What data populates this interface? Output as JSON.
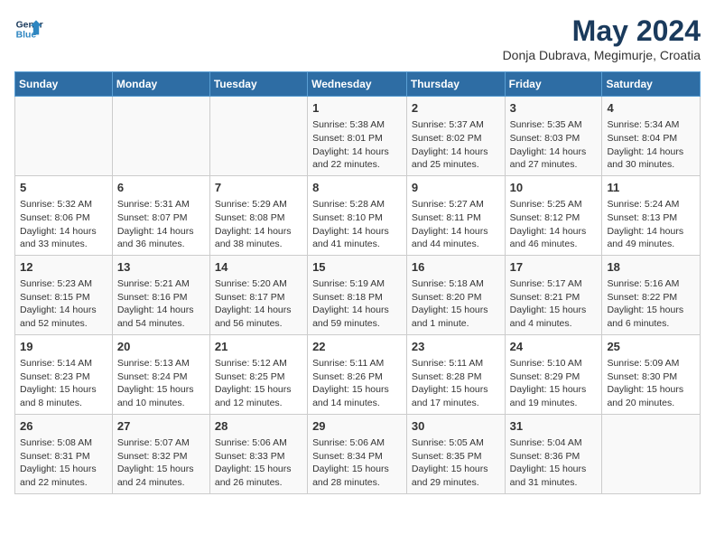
{
  "logo": {
    "line1": "General",
    "line2": "Blue"
  },
  "title": "May 2024",
  "subtitle": "Donja Dubrava, Megimurje, Croatia",
  "weekdays": [
    "Sunday",
    "Monday",
    "Tuesday",
    "Wednesday",
    "Thursday",
    "Friday",
    "Saturday"
  ],
  "weeks": [
    [
      {
        "day": "",
        "text": ""
      },
      {
        "day": "",
        "text": ""
      },
      {
        "day": "",
        "text": ""
      },
      {
        "day": "1",
        "text": "Sunrise: 5:38 AM\nSunset: 8:01 PM\nDaylight: 14 hours\nand 22 minutes."
      },
      {
        "day": "2",
        "text": "Sunrise: 5:37 AM\nSunset: 8:02 PM\nDaylight: 14 hours\nand 25 minutes."
      },
      {
        "day": "3",
        "text": "Sunrise: 5:35 AM\nSunset: 8:03 PM\nDaylight: 14 hours\nand 27 minutes."
      },
      {
        "day": "4",
        "text": "Sunrise: 5:34 AM\nSunset: 8:04 PM\nDaylight: 14 hours\nand 30 minutes."
      }
    ],
    [
      {
        "day": "5",
        "text": "Sunrise: 5:32 AM\nSunset: 8:06 PM\nDaylight: 14 hours\nand 33 minutes."
      },
      {
        "day": "6",
        "text": "Sunrise: 5:31 AM\nSunset: 8:07 PM\nDaylight: 14 hours\nand 36 minutes."
      },
      {
        "day": "7",
        "text": "Sunrise: 5:29 AM\nSunset: 8:08 PM\nDaylight: 14 hours\nand 38 minutes."
      },
      {
        "day": "8",
        "text": "Sunrise: 5:28 AM\nSunset: 8:10 PM\nDaylight: 14 hours\nand 41 minutes."
      },
      {
        "day": "9",
        "text": "Sunrise: 5:27 AM\nSunset: 8:11 PM\nDaylight: 14 hours\nand 44 minutes."
      },
      {
        "day": "10",
        "text": "Sunrise: 5:25 AM\nSunset: 8:12 PM\nDaylight: 14 hours\nand 46 minutes."
      },
      {
        "day": "11",
        "text": "Sunrise: 5:24 AM\nSunset: 8:13 PM\nDaylight: 14 hours\nand 49 minutes."
      }
    ],
    [
      {
        "day": "12",
        "text": "Sunrise: 5:23 AM\nSunset: 8:15 PM\nDaylight: 14 hours\nand 52 minutes."
      },
      {
        "day": "13",
        "text": "Sunrise: 5:21 AM\nSunset: 8:16 PM\nDaylight: 14 hours\nand 54 minutes."
      },
      {
        "day": "14",
        "text": "Sunrise: 5:20 AM\nSunset: 8:17 PM\nDaylight: 14 hours\nand 56 minutes."
      },
      {
        "day": "15",
        "text": "Sunrise: 5:19 AM\nSunset: 8:18 PM\nDaylight: 14 hours\nand 59 minutes."
      },
      {
        "day": "16",
        "text": "Sunrise: 5:18 AM\nSunset: 8:20 PM\nDaylight: 15 hours\nand 1 minute."
      },
      {
        "day": "17",
        "text": "Sunrise: 5:17 AM\nSunset: 8:21 PM\nDaylight: 15 hours\nand 4 minutes."
      },
      {
        "day": "18",
        "text": "Sunrise: 5:16 AM\nSunset: 8:22 PM\nDaylight: 15 hours\nand 6 minutes."
      }
    ],
    [
      {
        "day": "19",
        "text": "Sunrise: 5:14 AM\nSunset: 8:23 PM\nDaylight: 15 hours\nand 8 minutes."
      },
      {
        "day": "20",
        "text": "Sunrise: 5:13 AM\nSunset: 8:24 PM\nDaylight: 15 hours\nand 10 minutes."
      },
      {
        "day": "21",
        "text": "Sunrise: 5:12 AM\nSunset: 8:25 PM\nDaylight: 15 hours\nand 12 minutes."
      },
      {
        "day": "22",
        "text": "Sunrise: 5:11 AM\nSunset: 8:26 PM\nDaylight: 15 hours\nand 14 minutes."
      },
      {
        "day": "23",
        "text": "Sunrise: 5:11 AM\nSunset: 8:28 PM\nDaylight: 15 hours\nand 17 minutes."
      },
      {
        "day": "24",
        "text": "Sunrise: 5:10 AM\nSunset: 8:29 PM\nDaylight: 15 hours\nand 19 minutes."
      },
      {
        "day": "25",
        "text": "Sunrise: 5:09 AM\nSunset: 8:30 PM\nDaylight: 15 hours\nand 20 minutes."
      }
    ],
    [
      {
        "day": "26",
        "text": "Sunrise: 5:08 AM\nSunset: 8:31 PM\nDaylight: 15 hours\nand 22 minutes."
      },
      {
        "day": "27",
        "text": "Sunrise: 5:07 AM\nSunset: 8:32 PM\nDaylight: 15 hours\nand 24 minutes."
      },
      {
        "day": "28",
        "text": "Sunrise: 5:06 AM\nSunset: 8:33 PM\nDaylight: 15 hours\nand 26 minutes."
      },
      {
        "day": "29",
        "text": "Sunrise: 5:06 AM\nSunset: 8:34 PM\nDaylight: 15 hours\nand 28 minutes."
      },
      {
        "day": "30",
        "text": "Sunrise: 5:05 AM\nSunset: 8:35 PM\nDaylight: 15 hours\nand 29 minutes."
      },
      {
        "day": "31",
        "text": "Sunrise: 5:04 AM\nSunset: 8:36 PM\nDaylight: 15 hours\nand 31 minutes."
      },
      {
        "day": "",
        "text": ""
      }
    ]
  ]
}
